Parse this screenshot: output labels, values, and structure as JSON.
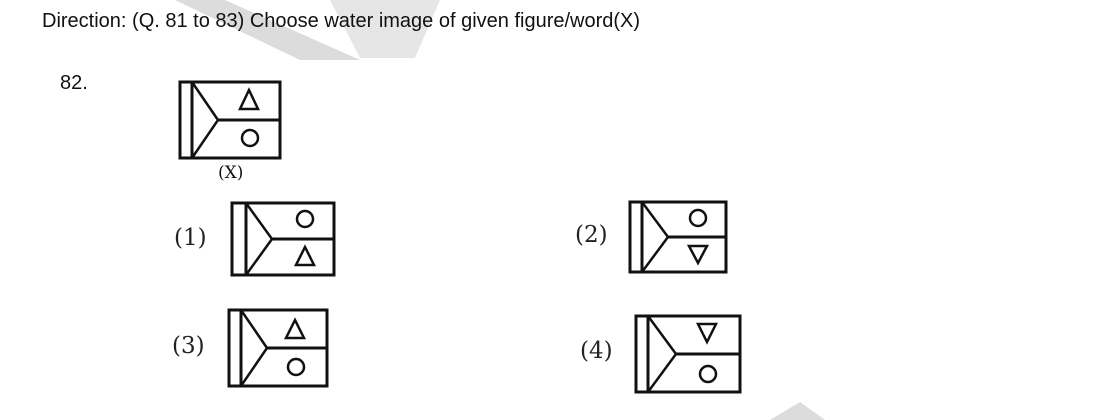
{
  "header": {
    "direction_text": "Direction: (Q. 81 to 83) Choose water image of given figure/word(X)"
  },
  "question": {
    "number": "82."
  },
  "question_figure": {
    "label": "(X)",
    "top_cell": "triangle-up",
    "bottom_cell": "circle"
  },
  "options": [
    {
      "label": "(1)",
      "top_cell": "circle",
      "bottom_cell": "triangle-up"
    },
    {
      "label": "(2)",
      "top_cell": "circle",
      "bottom_cell": "triangle-down"
    },
    {
      "label": "(3)",
      "top_cell": "triangle-up",
      "bottom_cell": "circle"
    },
    {
      "label": "(4)",
      "top_cell": "triangle-down",
      "bottom_cell": "circle"
    }
  ],
  "colors": {
    "ink": "#111111",
    "watermark": "#d9d9d9"
  }
}
